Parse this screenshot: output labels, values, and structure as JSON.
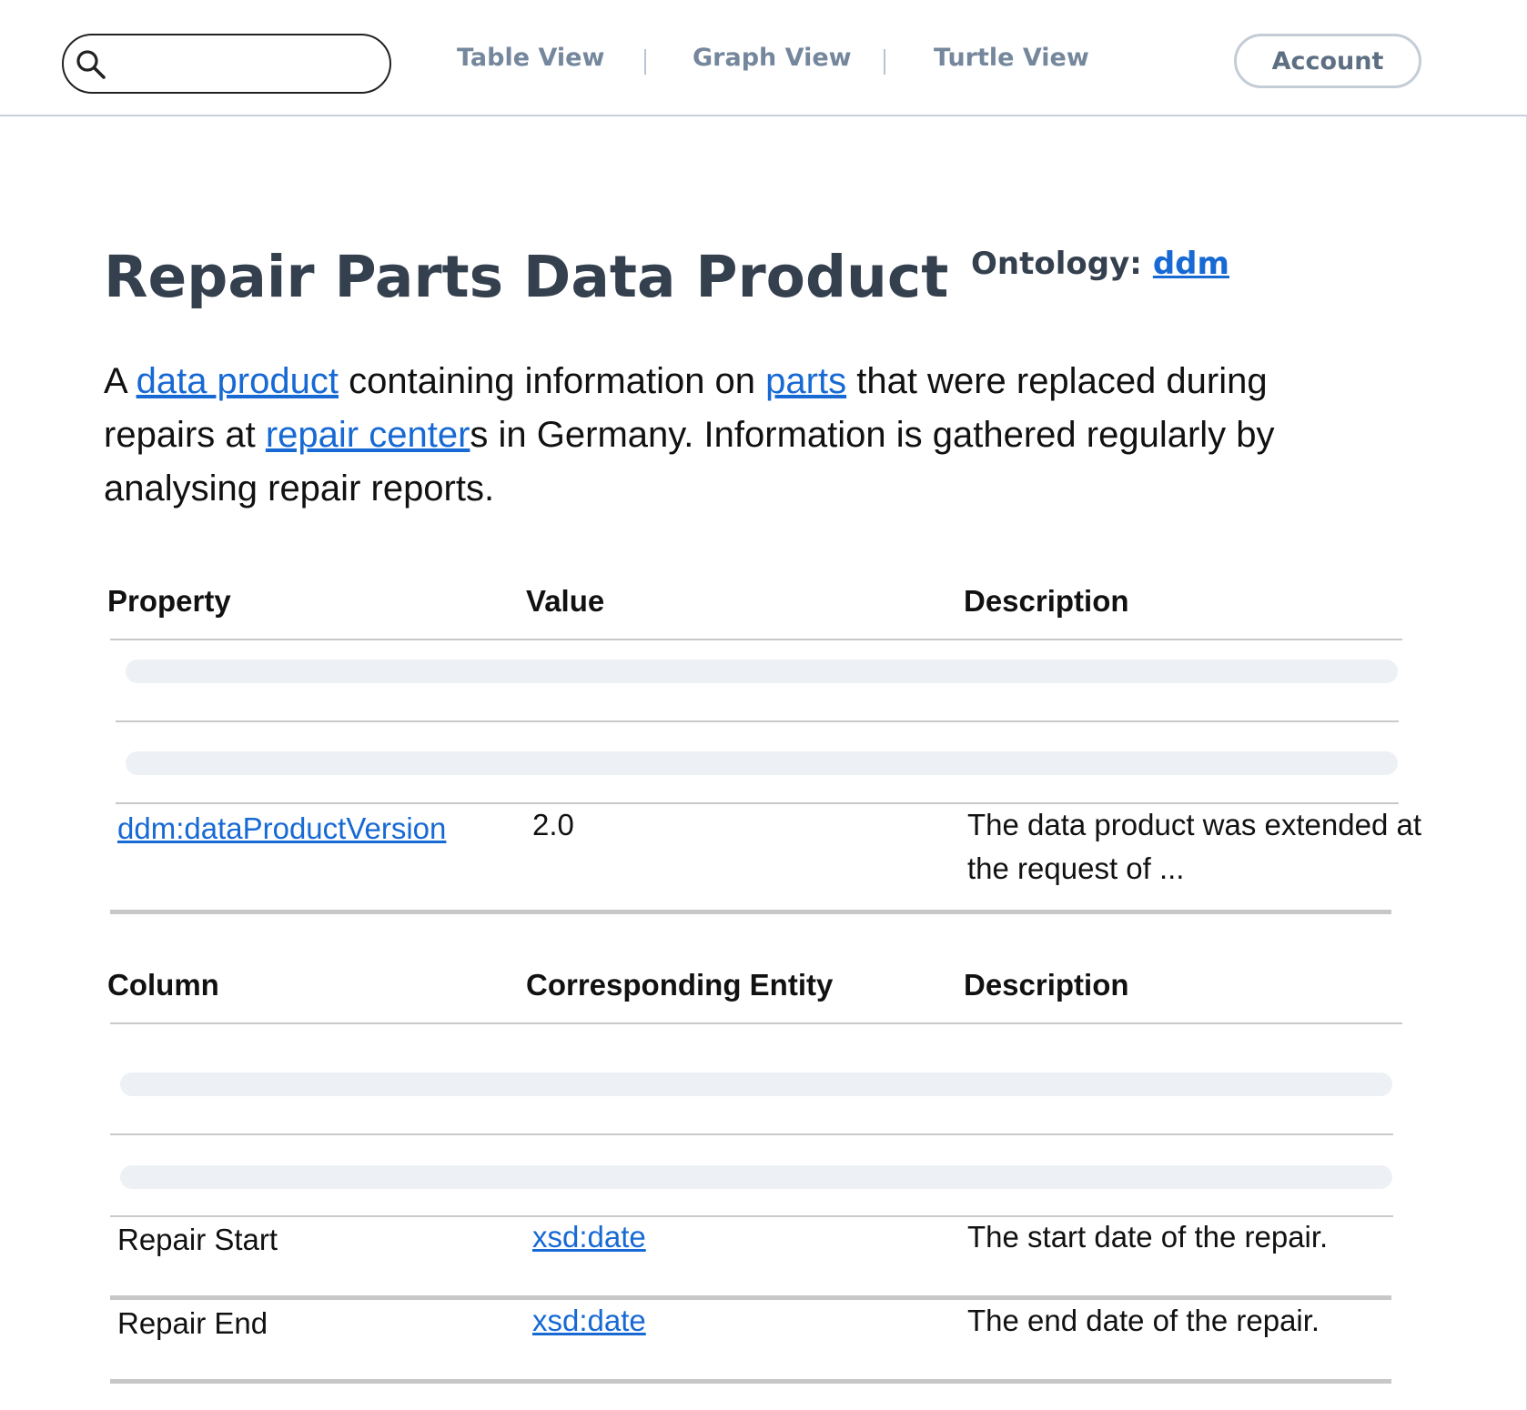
{
  "header": {
    "search": {
      "placeholder": "",
      "value": ""
    },
    "nav": [
      {
        "label": "Table View"
      },
      {
        "label": "Graph View"
      },
      {
        "label": "Turtle View"
      }
    ],
    "account_label": "Account"
  },
  "page": {
    "title": "Repair Parts Data Product",
    "ontology_label": "Ontology:",
    "ontology_link": "ddm",
    "description": {
      "p1": "A ",
      "link1": "data product",
      "p2": " containing information on ",
      "link2": "parts",
      "p3": " that were replaced during repairs at ",
      "link3": "repair center",
      "p4": "s in Germany. Information is gathered regularly by analysing repair reports."
    }
  },
  "properties_table": {
    "headers": [
      "Property",
      "Value",
      "Description"
    ],
    "loading_rows": 2,
    "rows": [
      {
        "property": "ddm:dataProductVersion",
        "value": "2.0",
        "description": "The data product was extended at the request of ..."
      }
    ]
  },
  "columns_table": {
    "headers": [
      "Column",
      "Corresponding Entity",
      "Description"
    ],
    "loading_rows": 2,
    "rows": [
      {
        "column": "Repair Start",
        "entity": "xsd:date",
        "description": "The start date of the repair."
      },
      {
        "column": "Repair End",
        "entity": "xsd:date",
        "description": "The end date of the repair."
      }
    ]
  },
  "colors": {
    "link": "#1769d4",
    "nav": "#75879c",
    "title": "#35404f",
    "skeleton": "#edf0f4"
  }
}
